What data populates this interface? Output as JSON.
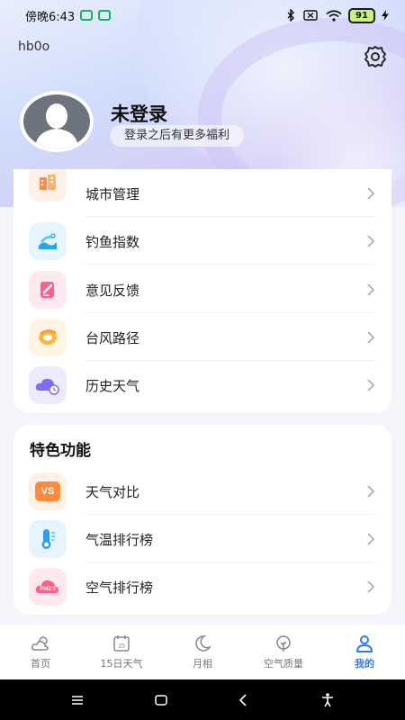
{
  "status_bar": {
    "time": "傍晚6:43",
    "battery": "91"
  },
  "header": {
    "app_tag": "hb0o"
  },
  "profile": {
    "name": "未登录",
    "subtitle": "登录之后有更多福利"
  },
  "menu_list": [
    {
      "label": "城市管理",
      "icon": "city-icon"
    },
    {
      "label": "钓鱼指数",
      "icon": "fishing-icon"
    },
    {
      "label": "意见反馈",
      "icon": "feedback-icon"
    },
    {
      "label": "台风路径",
      "icon": "typhoon-icon"
    },
    {
      "label": "历史天气",
      "icon": "history-weather-icon"
    }
  ],
  "features": {
    "title": "特色功能",
    "items": [
      {
        "label": "天气对比",
        "icon": "vs-icon",
        "icon_text": "VS"
      },
      {
        "label": "气温排行榜",
        "icon": "thermometer-icon"
      },
      {
        "label": "空气排行榜",
        "icon": "air-quality-icon",
        "icon_text": "PM2.5"
      }
    ]
  },
  "tabbar": {
    "tabs": [
      {
        "label": "首页",
        "icon": "home-weather-icon",
        "active": false
      },
      {
        "label": "15日天气",
        "icon": "calendar-icon",
        "active": false
      },
      {
        "label": "月相",
        "icon": "moon-icon",
        "active": false
      },
      {
        "label": "空气质量",
        "icon": "leaf-icon",
        "active": false
      },
      {
        "label": "我的",
        "icon": "user-icon",
        "active": true
      }
    ]
  },
  "colors": {
    "accent": "#2f7af6",
    "tab_inactive": "#777777"
  }
}
